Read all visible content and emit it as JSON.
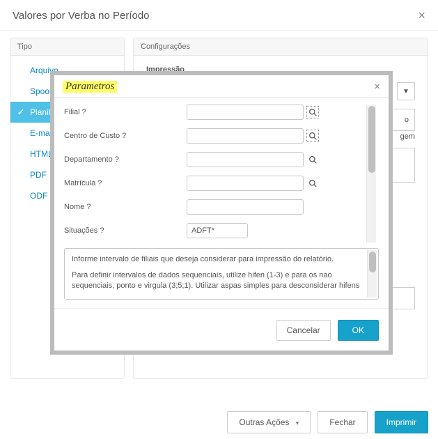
{
  "main": {
    "title": "Valores por Verba no Período",
    "close_glyph": "×"
  },
  "tipo": {
    "header": "Tipo",
    "items": [
      {
        "label": "Arquivo",
        "active": false
      },
      {
        "label": "Spool",
        "active": false
      },
      {
        "label": "Planilha",
        "active": true
      },
      {
        "label": "E-mail",
        "active": false
      },
      {
        "label": "HTML",
        "active": false
      },
      {
        "label": "PDF",
        "active": false
      },
      {
        "label": "ODF",
        "active": false
      }
    ]
  },
  "config": {
    "header": "Configurações",
    "section_label": "Impressão",
    "dropdown_glyph": "▼",
    "box_right_tail": "o",
    "box_right_tail2": "gem"
  },
  "bottom": {
    "other_actions": "Outras Ações",
    "close": "Fechar",
    "print": "Imprimir"
  },
  "modal": {
    "title": "Parametros",
    "close_glyph": "×",
    "fields": [
      {
        "label": "Filial ?",
        "value": "",
        "lookup": true,
        "boxed": true
      },
      {
        "label": "Centro de Custo ?",
        "value": "",
        "lookup": true,
        "boxed": true
      },
      {
        "label": "Departamento ?",
        "value": "",
        "lookup": true,
        "boxed": false
      },
      {
        "label": "Matrícula ?",
        "value": "",
        "lookup": true,
        "boxed": false
      },
      {
        "label": "Nome ?",
        "value": "",
        "lookup": false,
        "boxed": false
      },
      {
        "label": "Situações ?",
        "value": "ADFT*",
        "lookup": false,
        "boxed": false,
        "narrow": true
      }
    ],
    "help": {
      "line1": "Informe intervalo de filiais que deseja considerar para impressão do relatório.",
      "line2": "Para definir intervalos de dados sequenciais, utilize hifen (1-3) e para os nao sequenciais, ponto e virgula (3;5;1). Utilizar aspas simples para desconsiderar hifens"
    },
    "buttons": {
      "cancel": "Cancelar",
      "ok": "OK"
    }
  }
}
